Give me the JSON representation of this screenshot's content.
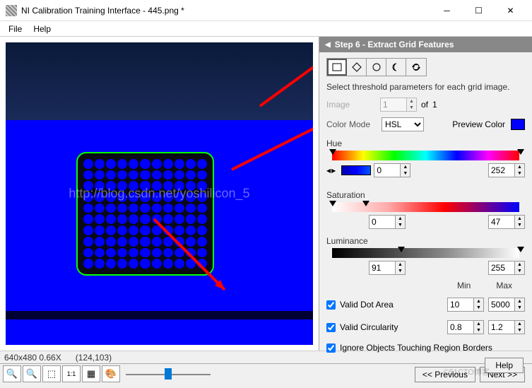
{
  "title": "NI Calibration Training Interface - 445.png *",
  "menu": {
    "file": "File",
    "help": "Help"
  },
  "status": {
    "dims": "640x480 0.66X",
    "coords": "(124,103)"
  },
  "step": {
    "header": "Step 6 - Extract Grid Features",
    "instruction": "Select threshold parameters for each grid image."
  },
  "image": {
    "label": "Image",
    "value": "1",
    "of": "of",
    "total": "1"
  },
  "colormode": {
    "label": "Color Mode",
    "value": "HSL",
    "previewlabel": "Preview Color",
    "previewcolor": "#0000ff"
  },
  "hue": {
    "label": "Hue",
    "min": "0",
    "max": "252"
  },
  "saturation": {
    "label": "Saturation",
    "min": "0",
    "max": "47"
  },
  "luminance": {
    "label": "Luminance",
    "min": "91",
    "max": "255"
  },
  "minmax": {
    "min": "Min",
    "max": "Max"
  },
  "validdot": {
    "label": "Valid Dot Area",
    "checked": true,
    "min": "10",
    "max": "5000"
  },
  "validcirc": {
    "label": "Valid Circularity",
    "checked": true,
    "min": "0.8",
    "max": "1.2"
  },
  "ignore": {
    "label": "Ignore Objects Touching Region Borders",
    "checked": true
  },
  "nav": {
    "prev": "<< Previous",
    "next": "Next >>"
  },
  "helpbtn": "Help",
  "watermark": "http://blog.csdn.net/yoshilicon_5",
  "watermark2": "©51CTO博客"
}
